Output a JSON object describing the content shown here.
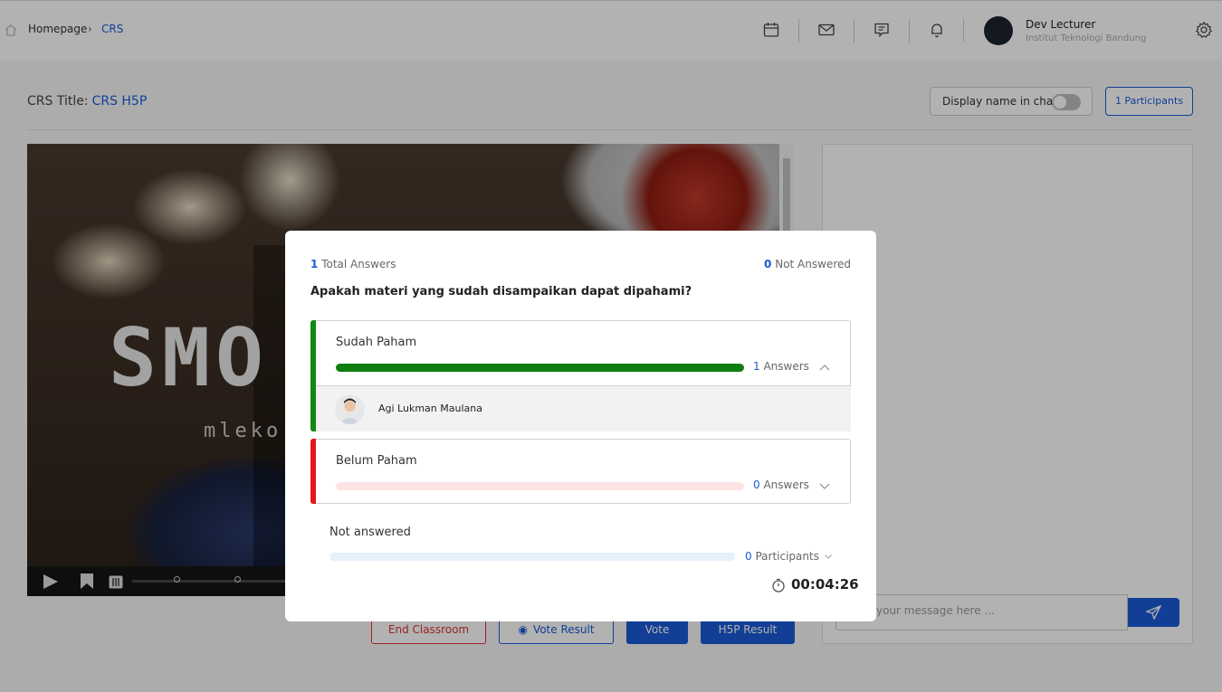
{
  "breadcrumb": {
    "home": "Homepage",
    "separator": "›",
    "current": "CRS"
  },
  "user": {
    "name": "Dev Lecturer",
    "institution": "Institut Teknologi Bandung"
  },
  "crs": {
    "title_label": "CRS Title:",
    "title_value": "CRS H5P"
  },
  "chat_toggle": {
    "label": "Display name in chat",
    "enabled": false
  },
  "participants_button": "1 Participants",
  "video": {
    "overlay_text": "SMO",
    "overlay_subtext": "mleko"
  },
  "buttons": {
    "end": "End Classroom",
    "vote_result": "Vote Result",
    "vote": "Vote",
    "h5p_result": "H5P Result"
  },
  "chat": {
    "placeholder": "your message here ..."
  },
  "poll": {
    "total_answers": "1",
    "total_answers_label": "Total Answers",
    "not_answered": "0",
    "not_answered_label": "Not Answered",
    "question": "Apakah materi yang sudah disampaikan dapat dipahami?",
    "options": [
      {
        "label": "Sudah Paham",
        "count": "1",
        "count_label": "Answers",
        "fill_fraction": 1.0,
        "color": "#0f7e10",
        "expanded": true,
        "respondents": [
          {
            "name": "Agi Lukman Maulana"
          }
        ]
      },
      {
        "label": "Belum Paham",
        "count": "0",
        "count_label": "Answers",
        "fill_fraction": 0.0,
        "color": "#e3171c",
        "expanded": false
      }
    ],
    "not_answered_section": {
      "label": "Not answered",
      "count": "0",
      "count_label": "Participants"
    },
    "timer": "00:04:26"
  },
  "colors": {
    "accent": "#1a5bd6",
    "success": "#0f7e10",
    "danger": "#e3171c"
  }
}
